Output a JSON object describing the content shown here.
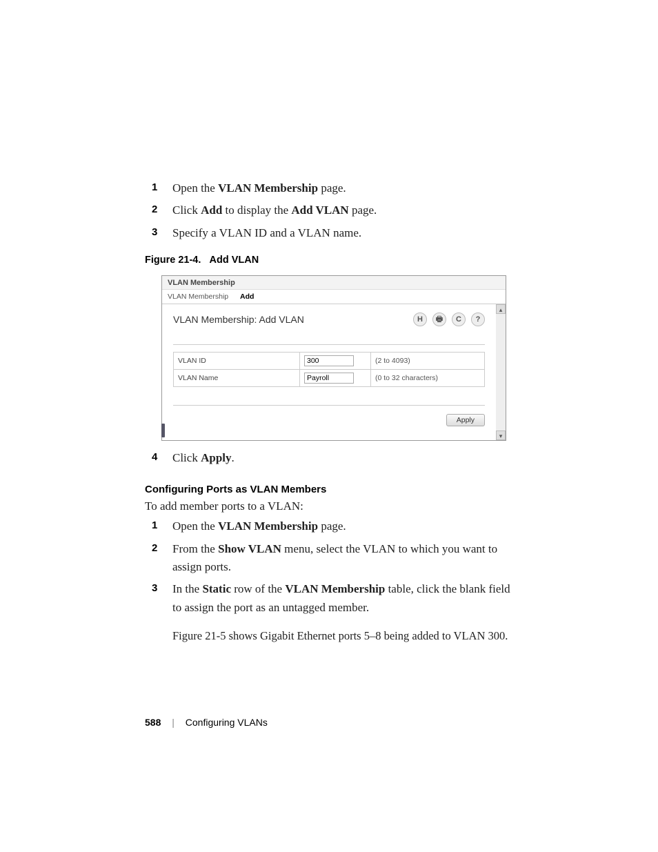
{
  "steps_a": [
    {
      "n": "1",
      "parts": [
        "Open the ",
        "VLAN Membership",
        " page."
      ]
    },
    {
      "n": "2",
      "parts": [
        "Click ",
        "Add",
        " to display the ",
        "Add VLAN",
        " page."
      ]
    },
    {
      "n": "3",
      "parts": [
        "Specify a VLAN ID and a VLAN name."
      ]
    }
  ],
  "figure_caption_prefix": "Figure 21-4.",
  "figure_caption_title": "Add VLAN",
  "shot": {
    "titlebar": "VLAN Membership",
    "breadcrumb": [
      "VLAN Membership",
      "Add"
    ],
    "heading": "VLAN Membership: Add VLAN",
    "icons": {
      "save": "H",
      "print": "🖶",
      "refresh": "C",
      "help": "?"
    },
    "rows": [
      {
        "label": "VLAN ID",
        "value": "300",
        "hint": "(2 to 4093)"
      },
      {
        "label": "VLAN Name",
        "value": "Payroll",
        "hint": "(0 to 32 characters)"
      }
    ],
    "apply": "Apply"
  },
  "step4": {
    "n": "4",
    "parts": [
      "Click ",
      "Apply",
      "."
    ]
  },
  "subhead": "Configuring Ports as VLAN Members",
  "intro": "To add member ports to a VLAN:",
  "steps_b": [
    {
      "n": "1",
      "parts": [
        "Open the ",
        "VLAN Membership",
        " page."
      ]
    },
    {
      "n": "2",
      "parts": [
        "From the ",
        "Show VLAN",
        " menu, select the VLAN to which you want to assign ports."
      ]
    },
    {
      "n": "3",
      "parts": [
        "In the ",
        "Static",
        " row of the ",
        "VLAN Membership",
        " table, click the blank field to assign the port as an untagged member."
      ]
    }
  ],
  "after_fig": "Figure 21-5 shows Gigabit Ethernet ports 5–8 being added to VLAN 300.",
  "footer": {
    "page": "588",
    "section": "Configuring VLANs"
  }
}
